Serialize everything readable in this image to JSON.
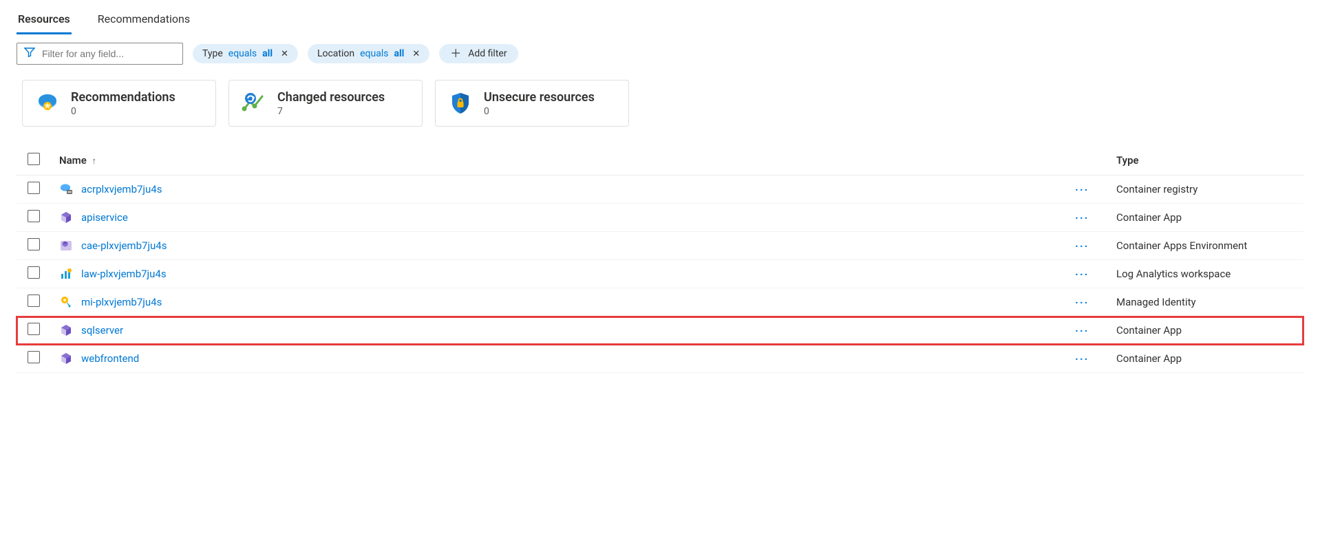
{
  "tabs": [
    {
      "label": "Resources",
      "active": true
    },
    {
      "label": "Recommendations",
      "active": false
    }
  ],
  "filters": {
    "placeholder": "Filter for any field...",
    "pills": [
      {
        "field": "Type",
        "op": "equals",
        "value": "all"
      },
      {
        "field": "Location",
        "op": "equals",
        "value": "all"
      }
    ],
    "add_label": "Add filter"
  },
  "cards": [
    {
      "title": "Recommendations",
      "count": "0",
      "icon": "recommendations-icon"
    },
    {
      "title": "Changed resources",
      "count": "7",
      "icon": "changed-resources-icon"
    },
    {
      "title": "Unsecure resources",
      "count": "0",
      "icon": "unsecure-resources-icon"
    }
  ],
  "columns": {
    "name": "Name",
    "type": "Type"
  },
  "rows": [
    {
      "name": "acrplxvjemb7ju4s",
      "type": "Container registry",
      "icon": "container-registry-icon",
      "highlight": false
    },
    {
      "name": "apiservice",
      "type": "Container App",
      "icon": "container-app-icon",
      "highlight": false
    },
    {
      "name": "cae-plxvjemb7ju4s",
      "type": "Container Apps Environment",
      "icon": "container-apps-env-icon",
      "highlight": false
    },
    {
      "name": "law-plxvjemb7ju4s",
      "type": "Log Analytics workspace",
      "icon": "log-analytics-icon",
      "highlight": false
    },
    {
      "name": "mi-plxvjemb7ju4s",
      "type": "Managed Identity",
      "icon": "managed-identity-icon",
      "highlight": false
    },
    {
      "name": "sqlserver",
      "type": "Container App",
      "icon": "container-app-icon",
      "highlight": true
    },
    {
      "name": "webfrontend",
      "type": "Container App",
      "icon": "container-app-icon",
      "highlight": false
    }
  ]
}
